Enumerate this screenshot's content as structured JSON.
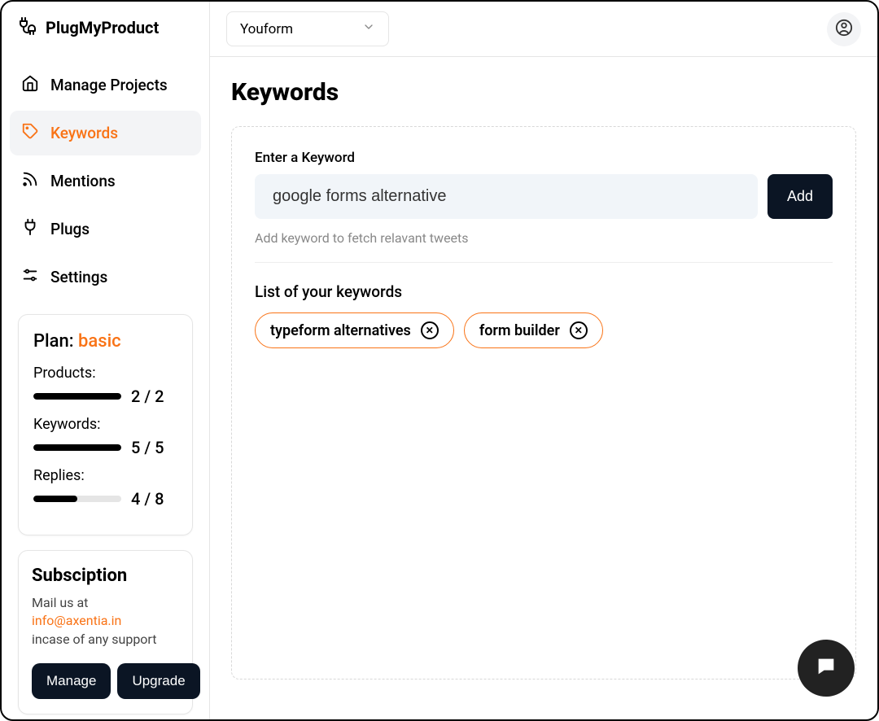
{
  "brand": {
    "name": "PlugMyProduct"
  },
  "nav": {
    "items": [
      {
        "label": "Manage Projects"
      },
      {
        "label": "Keywords"
      },
      {
        "label": "Mentions"
      },
      {
        "label": "Plugs"
      },
      {
        "label": "Settings"
      }
    ]
  },
  "plan": {
    "title_prefix": "Plan: ",
    "name": "basic",
    "stats": [
      {
        "label": "Products:",
        "used": 2,
        "total": 2,
        "pct": 100
      },
      {
        "label": "Keywords:",
        "used": 5,
        "total": 5,
        "pct": 100
      },
      {
        "label": "Replies:",
        "used": 4,
        "total": 8,
        "pct": 50
      }
    ]
  },
  "subscription": {
    "title": "Subsciption",
    "line1": "Mail us at",
    "email": "info@axentia.in",
    "line2": "incase of any support",
    "manage": "Manage",
    "upgrade": "Upgrade"
  },
  "topbar": {
    "project_selected": "Youform"
  },
  "page": {
    "title": "Keywords",
    "field_label": "Enter a Keyword",
    "input_value": "google forms alternative",
    "add_label": "Add",
    "helper": "Add keyword to fetch relavant tweets",
    "list_title": "List of your keywords",
    "keywords": [
      {
        "label": "typeform alternatives"
      },
      {
        "label": "form builder"
      }
    ]
  }
}
